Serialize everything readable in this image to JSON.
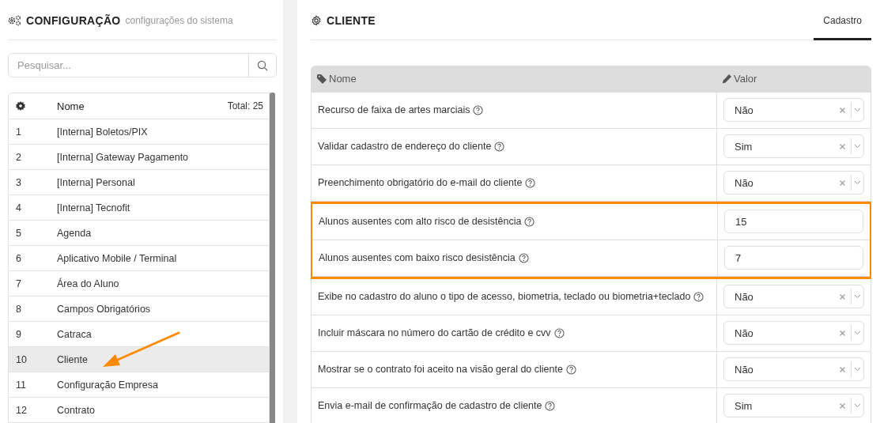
{
  "sidebar": {
    "title": "CONFIGURAÇÃO",
    "subtitle": "configurações do sistema",
    "search": {
      "placeholder": "Pesquisar..."
    },
    "list": {
      "columns": [
        "Nome"
      ],
      "total": "Total: 25",
      "rows": [
        {
          "number": "1",
          "name": "[Interna] Boletos/PIX",
          "selected": false,
          "annotated": false
        },
        {
          "number": "2",
          "name": "[Interna] Gateway Pagamento",
          "selected": false,
          "annotated": false
        },
        {
          "number": "3",
          "name": "[Interna] Personal",
          "selected": false,
          "annotated": false
        },
        {
          "number": "4",
          "name": "[Interna] Tecnofit",
          "selected": false,
          "annotated": false
        },
        {
          "number": "5",
          "name": "Agenda",
          "selected": false,
          "annotated": false
        },
        {
          "number": "6",
          "name": "Aplicativo Mobile / Terminal",
          "selected": false,
          "annotated": false
        },
        {
          "number": "7",
          "name": "Área do Aluno",
          "selected": false,
          "annotated": false
        },
        {
          "number": "8",
          "name": "Campos Obrigatórios",
          "selected": false,
          "annotated": false
        },
        {
          "number": "9",
          "name": "Catraca",
          "selected": false,
          "annotated": false
        },
        {
          "number": "10",
          "name": "Cliente",
          "selected": true,
          "annotated": true
        },
        {
          "number": "11",
          "name": "Configuração Empresa",
          "selected": false,
          "annotated": false
        },
        {
          "number": "12",
          "name": "Contrato",
          "selected": false,
          "annotated": false
        }
      ]
    }
  },
  "main": {
    "title": "CLIENTE",
    "tabs": [
      {
        "label": "Cadastro",
        "selected": true
      }
    ],
    "table": {
      "columns": [
        "Nome",
        "Valor"
      ],
      "rows": [
        {
          "name": "Recurso de faixa de artes marciais",
          "kind": "select",
          "value": "Não",
          "highlighted": false
        },
        {
          "name": "Validar cadastro de endereço do cliente",
          "kind": "select",
          "value": "Sim",
          "highlighted": false
        },
        {
          "name": "Preenchimento obrigatório do e-mail do cliente",
          "kind": "select",
          "value": "Não",
          "highlighted": false
        },
        {
          "name": "Alunos ausentes com alto risco de desistência",
          "kind": "number",
          "value": "15",
          "highlighted": true
        },
        {
          "name": "Alunos ausentes com baixo risco desistência",
          "kind": "number",
          "value": "7",
          "highlighted": true
        },
        {
          "name": "Exibe no cadastro do aluno o tipo de acesso, biometria, teclado ou biometria+teclado",
          "kind": "select",
          "value": "Não",
          "highlighted": false
        },
        {
          "name": "Incluir máscara no número do cartão de crédito e cvv",
          "kind": "select",
          "value": "Não",
          "highlighted": false
        },
        {
          "name": "Mostrar se o contrato foi aceito na visão geral do cliente",
          "kind": "select",
          "value": "Não",
          "highlighted": false
        },
        {
          "name": "Envia e-mail de confirmação de cadastro de cliente",
          "kind": "select",
          "value": "Sim",
          "highlighted": false
        }
      ]
    }
  }
}
